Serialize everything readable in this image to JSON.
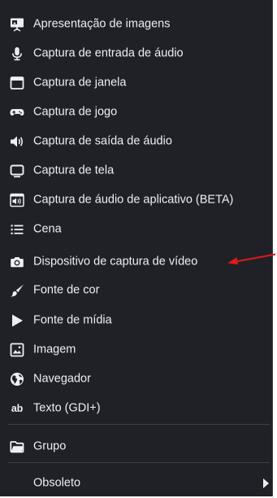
{
  "menu": {
    "items": [
      {
        "label": "Apresentação de imagens",
        "icon": "slideshow-icon"
      },
      {
        "label": "Captura de entrada de áudio",
        "icon": "microphone-icon"
      },
      {
        "label": "Captura de janela",
        "icon": "window-icon"
      },
      {
        "label": "Captura de jogo",
        "icon": "gamepad-icon"
      },
      {
        "label": "Captura de saída de áudio",
        "icon": "speaker-icon"
      },
      {
        "label": "Captura de tela",
        "icon": "monitor-icon"
      },
      {
        "label": "Captura de áudio de aplicativo (BETA)",
        "icon": "app-audio-icon"
      },
      {
        "label": "Cena",
        "icon": "list-icon"
      },
      {
        "label": "Dispositivo de captura de vídeo",
        "icon": "camera-icon"
      },
      {
        "label": "Fonte de cor",
        "icon": "brush-icon"
      },
      {
        "label": "Fonte de mídia",
        "icon": "play-icon"
      },
      {
        "label": "Imagem",
        "icon": "image-icon"
      },
      {
        "label": "Navegador",
        "icon": "globe-icon"
      },
      {
        "label": "Texto (GDI+)",
        "icon": "text-icon"
      },
      {
        "label": "Grupo",
        "icon": "folder-icon"
      },
      {
        "label": "Obsoleto",
        "icon": "submenu-arrow-icon"
      }
    ],
    "text_icon_glyph": "ab"
  },
  "colors": {
    "menu_background": "#1f2127",
    "text": "#eceff3",
    "annotation_arrow": "#e0191b"
  }
}
